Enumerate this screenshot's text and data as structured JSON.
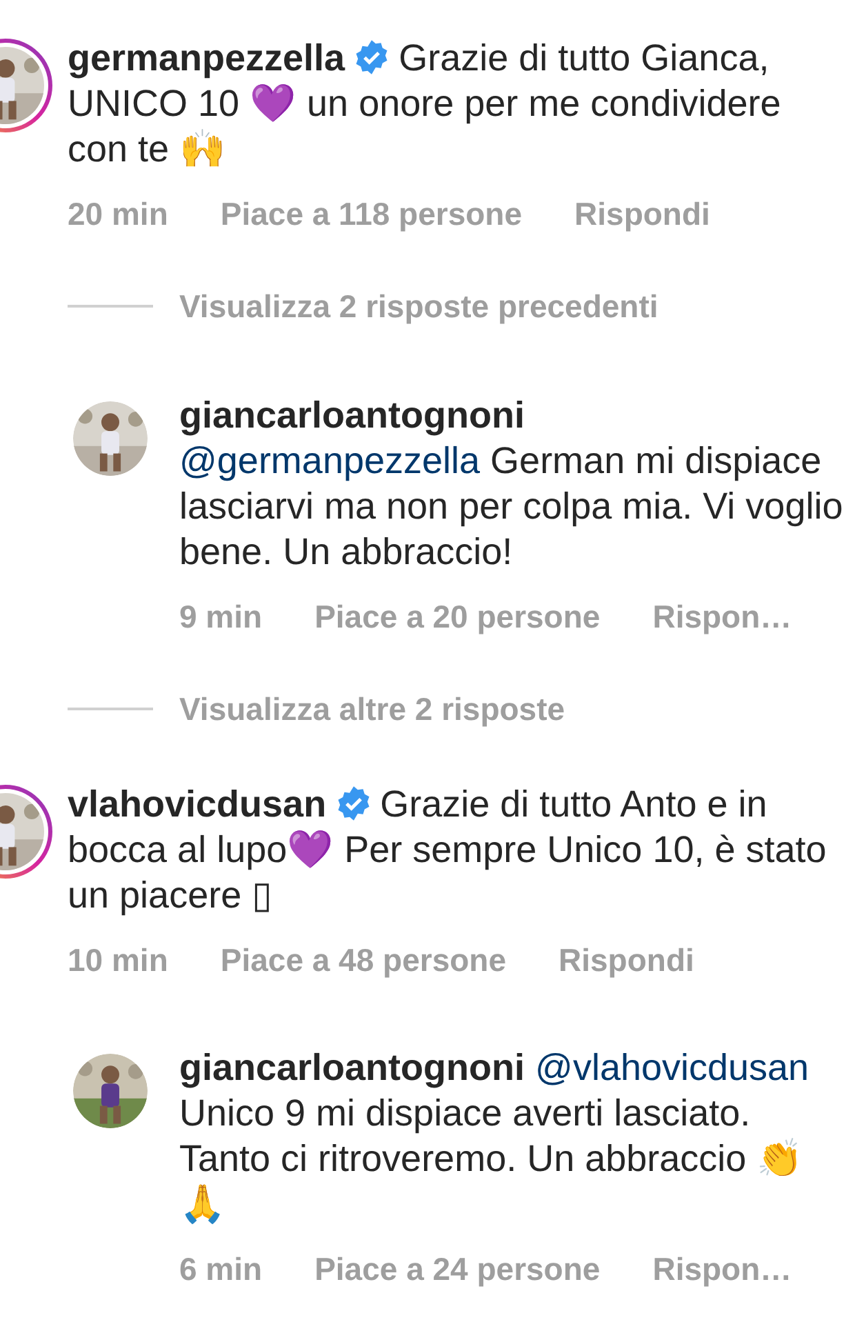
{
  "items": [
    {
      "kind": "comment",
      "username": "germanpezzella",
      "verified": true,
      "story": true,
      "text": "Grazie di tutto Gianca, UNICO 10 💜 un onore per me condividere con te 🙌",
      "time": "20 min",
      "likes": "Piace a 118 persone",
      "reply": "Rispondi"
    },
    {
      "kind": "view_more",
      "label": "Visualizza 2 risposte precedenti"
    },
    {
      "kind": "reply",
      "username": "giancarloantognoni",
      "verified": false,
      "story": false,
      "mention": "@germanpezzella",
      "mention_inline": false,
      "text": "German mi dispiace lasciarvi ma non per colpa mia. Vi voglio bene. Un abbraccio!",
      "time": "9 min",
      "likes": "Piace a 20 persone",
      "reply": "Rispon…"
    },
    {
      "kind": "view_more",
      "label": "Visualizza altre 2 risposte"
    },
    {
      "kind": "comment",
      "username": "vlahovicdusan",
      "verified": true,
      "story": true,
      "text": "Grazie di tutto Anto e in bocca al lupo💜 Per sempre Unico 10, è stato un piacere ▯",
      "time": "10 min",
      "likes": "Piace a 48 persone",
      "reply": "Rispondi"
    },
    {
      "kind": "reply",
      "username": "giancarloantognoni",
      "verified": false,
      "story": false,
      "mention": "@vlahovicdusan",
      "mention_inline": true,
      "text": "Unico 9 mi dispiace averti lasciato. Tanto ci ritroveremo. Un abbraccio 👏🙏",
      "time": "6 min",
      "likes": "Piace a 24 persone",
      "reply": "Rispon…"
    }
  ]
}
